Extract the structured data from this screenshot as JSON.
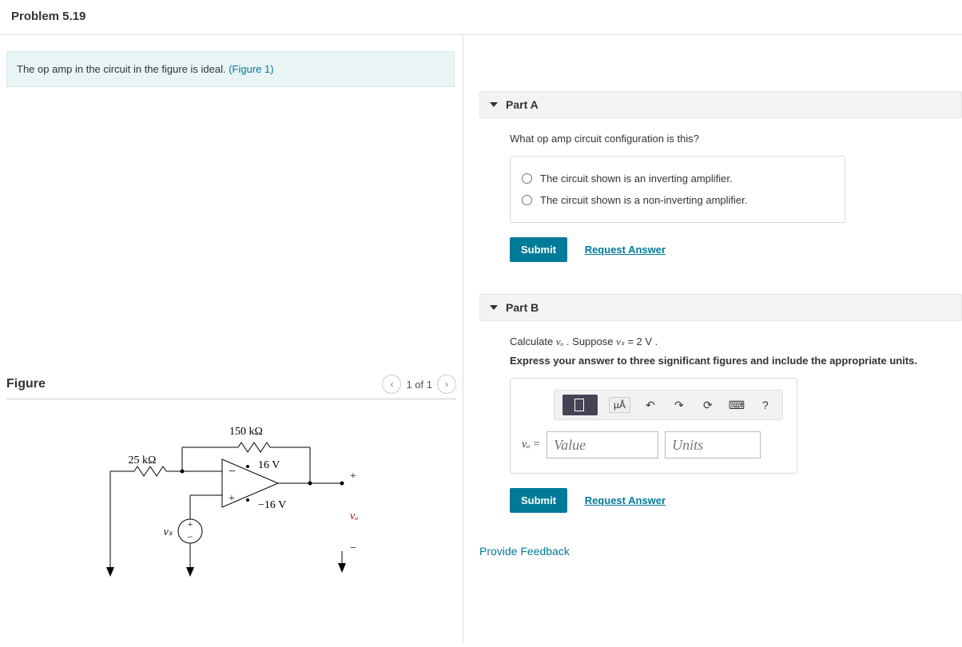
{
  "header": {
    "title": "Problem 5.19"
  },
  "prompt": {
    "text": "The op amp in the circuit in the figure is ideal. ",
    "link_text": "(Figure 1)"
  },
  "figure": {
    "heading": "Figure",
    "pager_text": "1 of 1",
    "labels": {
      "r_fb": "150 kΩ",
      "r_in": "25 kΩ",
      "v_pos": "16 V",
      "v_neg": "−16 V",
      "v_src": "vₛ",
      "v_out": "vₒ"
    }
  },
  "partA": {
    "title": "Part A",
    "question": "What op amp circuit configuration is this?",
    "options": [
      "The circuit shown is an inverting amplifier.",
      "The circuit shown is a non-inverting amplifier."
    ],
    "submit_label": "Submit",
    "request_answer_label": "Request Answer"
  },
  "partB": {
    "title": "Part B",
    "question_prefix": "Calculate ",
    "question_vo": "vₒ",
    "question_mid": ". Suppose ",
    "question_vs": "vₛ",
    "question_suffix": " = 2  V .",
    "hint": "Express your answer to three significant figures and include the appropriate units.",
    "eq_label_var": "vₒ",
    "eq_label_eq": " = ",
    "value_placeholder": "Value",
    "units_placeholder": "Units",
    "toolbar": {
      "ua_label": "µÅ"
    },
    "submit_label": "Submit",
    "request_answer_label": "Request Answer"
  },
  "feedback_label": "Provide Feedback"
}
